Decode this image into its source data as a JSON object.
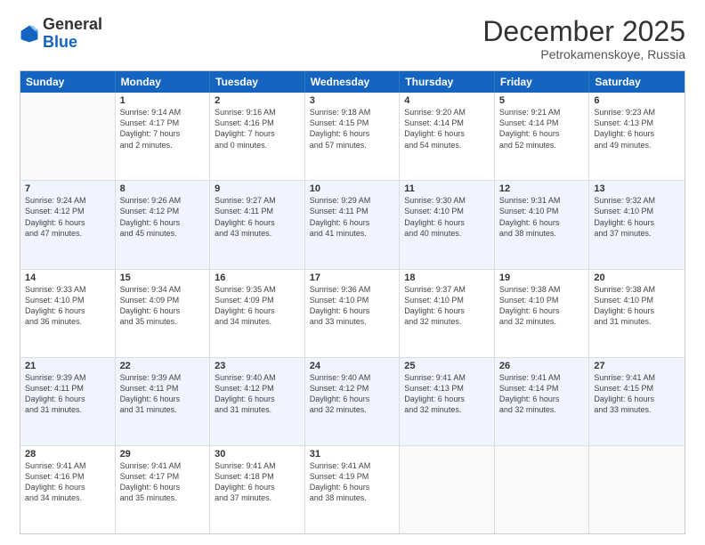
{
  "header": {
    "logo_general": "General",
    "logo_blue": "Blue",
    "month_year": "December 2025",
    "location": "Petrokamenskoye, Russia"
  },
  "weekdays": [
    "Sunday",
    "Monday",
    "Tuesday",
    "Wednesday",
    "Thursday",
    "Friday",
    "Saturday"
  ],
  "rows": [
    [
      {
        "day": "",
        "info": ""
      },
      {
        "day": "1",
        "info": "Sunrise: 9:14 AM\nSunset: 4:17 PM\nDaylight: 7 hours\nand 2 minutes."
      },
      {
        "day": "2",
        "info": "Sunrise: 9:16 AM\nSunset: 4:16 PM\nDaylight: 7 hours\nand 0 minutes."
      },
      {
        "day": "3",
        "info": "Sunrise: 9:18 AM\nSunset: 4:15 PM\nDaylight: 6 hours\nand 57 minutes."
      },
      {
        "day": "4",
        "info": "Sunrise: 9:20 AM\nSunset: 4:14 PM\nDaylight: 6 hours\nand 54 minutes."
      },
      {
        "day": "5",
        "info": "Sunrise: 9:21 AM\nSunset: 4:14 PM\nDaylight: 6 hours\nand 52 minutes."
      },
      {
        "day": "6",
        "info": "Sunrise: 9:23 AM\nSunset: 4:13 PM\nDaylight: 6 hours\nand 49 minutes."
      }
    ],
    [
      {
        "day": "7",
        "info": "Sunrise: 9:24 AM\nSunset: 4:12 PM\nDaylight: 6 hours\nand 47 minutes."
      },
      {
        "day": "8",
        "info": "Sunrise: 9:26 AM\nSunset: 4:12 PM\nDaylight: 6 hours\nand 45 minutes."
      },
      {
        "day": "9",
        "info": "Sunrise: 9:27 AM\nSunset: 4:11 PM\nDaylight: 6 hours\nand 43 minutes."
      },
      {
        "day": "10",
        "info": "Sunrise: 9:29 AM\nSunset: 4:11 PM\nDaylight: 6 hours\nand 41 minutes."
      },
      {
        "day": "11",
        "info": "Sunrise: 9:30 AM\nSunset: 4:10 PM\nDaylight: 6 hours\nand 40 minutes."
      },
      {
        "day": "12",
        "info": "Sunrise: 9:31 AM\nSunset: 4:10 PM\nDaylight: 6 hours\nand 38 minutes."
      },
      {
        "day": "13",
        "info": "Sunrise: 9:32 AM\nSunset: 4:10 PM\nDaylight: 6 hours\nand 37 minutes."
      }
    ],
    [
      {
        "day": "14",
        "info": "Sunrise: 9:33 AM\nSunset: 4:10 PM\nDaylight: 6 hours\nand 36 minutes."
      },
      {
        "day": "15",
        "info": "Sunrise: 9:34 AM\nSunset: 4:09 PM\nDaylight: 6 hours\nand 35 minutes."
      },
      {
        "day": "16",
        "info": "Sunrise: 9:35 AM\nSunset: 4:09 PM\nDaylight: 6 hours\nand 34 minutes."
      },
      {
        "day": "17",
        "info": "Sunrise: 9:36 AM\nSunset: 4:10 PM\nDaylight: 6 hours\nand 33 minutes."
      },
      {
        "day": "18",
        "info": "Sunrise: 9:37 AM\nSunset: 4:10 PM\nDaylight: 6 hours\nand 32 minutes."
      },
      {
        "day": "19",
        "info": "Sunrise: 9:38 AM\nSunset: 4:10 PM\nDaylight: 6 hours\nand 32 minutes."
      },
      {
        "day": "20",
        "info": "Sunrise: 9:38 AM\nSunset: 4:10 PM\nDaylight: 6 hours\nand 31 minutes."
      }
    ],
    [
      {
        "day": "21",
        "info": "Sunrise: 9:39 AM\nSunset: 4:11 PM\nDaylight: 6 hours\nand 31 minutes."
      },
      {
        "day": "22",
        "info": "Sunrise: 9:39 AM\nSunset: 4:11 PM\nDaylight: 6 hours\nand 31 minutes."
      },
      {
        "day": "23",
        "info": "Sunrise: 9:40 AM\nSunset: 4:12 PM\nDaylight: 6 hours\nand 31 minutes."
      },
      {
        "day": "24",
        "info": "Sunrise: 9:40 AM\nSunset: 4:12 PM\nDaylight: 6 hours\nand 32 minutes."
      },
      {
        "day": "25",
        "info": "Sunrise: 9:41 AM\nSunset: 4:13 PM\nDaylight: 6 hours\nand 32 minutes."
      },
      {
        "day": "26",
        "info": "Sunrise: 9:41 AM\nSunset: 4:14 PM\nDaylight: 6 hours\nand 32 minutes."
      },
      {
        "day": "27",
        "info": "Sunrise: 9:41 AM\nSunset: 4:15 PM\nDaylight: 6 hours\nand 33 minutes."
      }
    ],
    [
      {
        "day": "28",
        "info": "Sunrise: 9:41 AM\nSunset: 4:16 PM\nDaylight: 6 hours\nand 34 minutes."
      },
      {
        "day": "29",
        "info": "Sunrise: 9:41 AM\nSunset: 4:17 PM\nDaylight: 6 hours\nand 35 minutes."
      },
      {
        "day": "30",
        "info": "Sunrise: 9:41 AM\nSunset: 4:18 PM\nDaylight: 6 hours\nand 37 minutes."
      },
      {
        "day": "31",
        "info": "Sunrise: 9:41 AM\nSunset: 4:19 PM\nDaylight: 6 hours\nand 38 minutes."
      },
      {
        "day": "",
        "info": ""
      },
      {
        "day": "",
        "info": ""
      },
      {
        "day": "",
        "info": ""
      }
    ]
  ]
}
